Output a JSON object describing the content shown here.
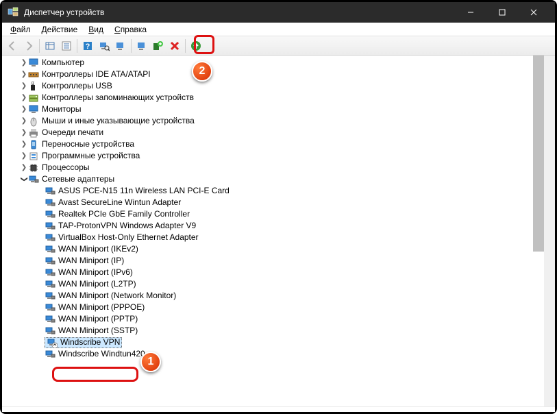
{
  "window": {
    "title": "Диспетчер устройств"
  },
  "menu": {
    "file": "Файл",
    "action": "Действие",
    "view": "Вид",
    "help": "Справка"
  },
  "badges": {
    "one": "1",
    "two": "2"
  },
  "tree": {
    "collapsed": [
      {
        "label": "Компьютер",
        "icon": "monitor"
      },
      {
        "label": "Контроллеры IDE ATA/ATAPI",
        "icon": "ide"
      },
      {
        "label": "Контроллеры USB",
        "icon": "usb"
      },
      {
        "label": "Контроллеры запоминающих устройств",
        "icon": "storage"
      },
      {
        "label": "Мониторы",
        "icon": "monitor"
      },
      {
        "label": "Мыши и иные указывающие устройства",
        "icon": "mouse"
      },
      {
        "label": "Очереди печати",
        "icon": "printer"
      },
      {
        "label": "Переносные устройства",
        "icon": "portable"
      },
      {
        "label": "Программные устройства",
        "icon": "software"
      },
      {
        "label": "Процессоры",
        "icon": "cpu"
      }
    ],
    "expanded": {
      "label": "Сетевые адаптеры",
      "children": [
        "ASUS PCE-N15 11n Wireless LAN PCI-E Card",
        "Avast SecureLine Wintun Adapter",
        "Realtek PCIe GbE Family Controller",
        "TAP-ProtonVPN Windows Adapter V9",
        "VirtualBox Host-Only Ethernet Adapter",
        "WAN Miniport (IKEv2)",
        "WAN Miniport (IP)",
        "WAN Miniport (IPv6)",
        "WAN Miniport (L2TP)",
        "WAN Miniport (Network Monitor)",
        "WAN Miniport (PPPOE)",
        "WAN Miniport (PPTP)",
        "WAN Miniport (SSTP)",
        "Windscribe VPN",
        "Windscribe Windtun420"
      ],
      "selected_index": 13,
      "disabled_index": 13
    }
  }
}
